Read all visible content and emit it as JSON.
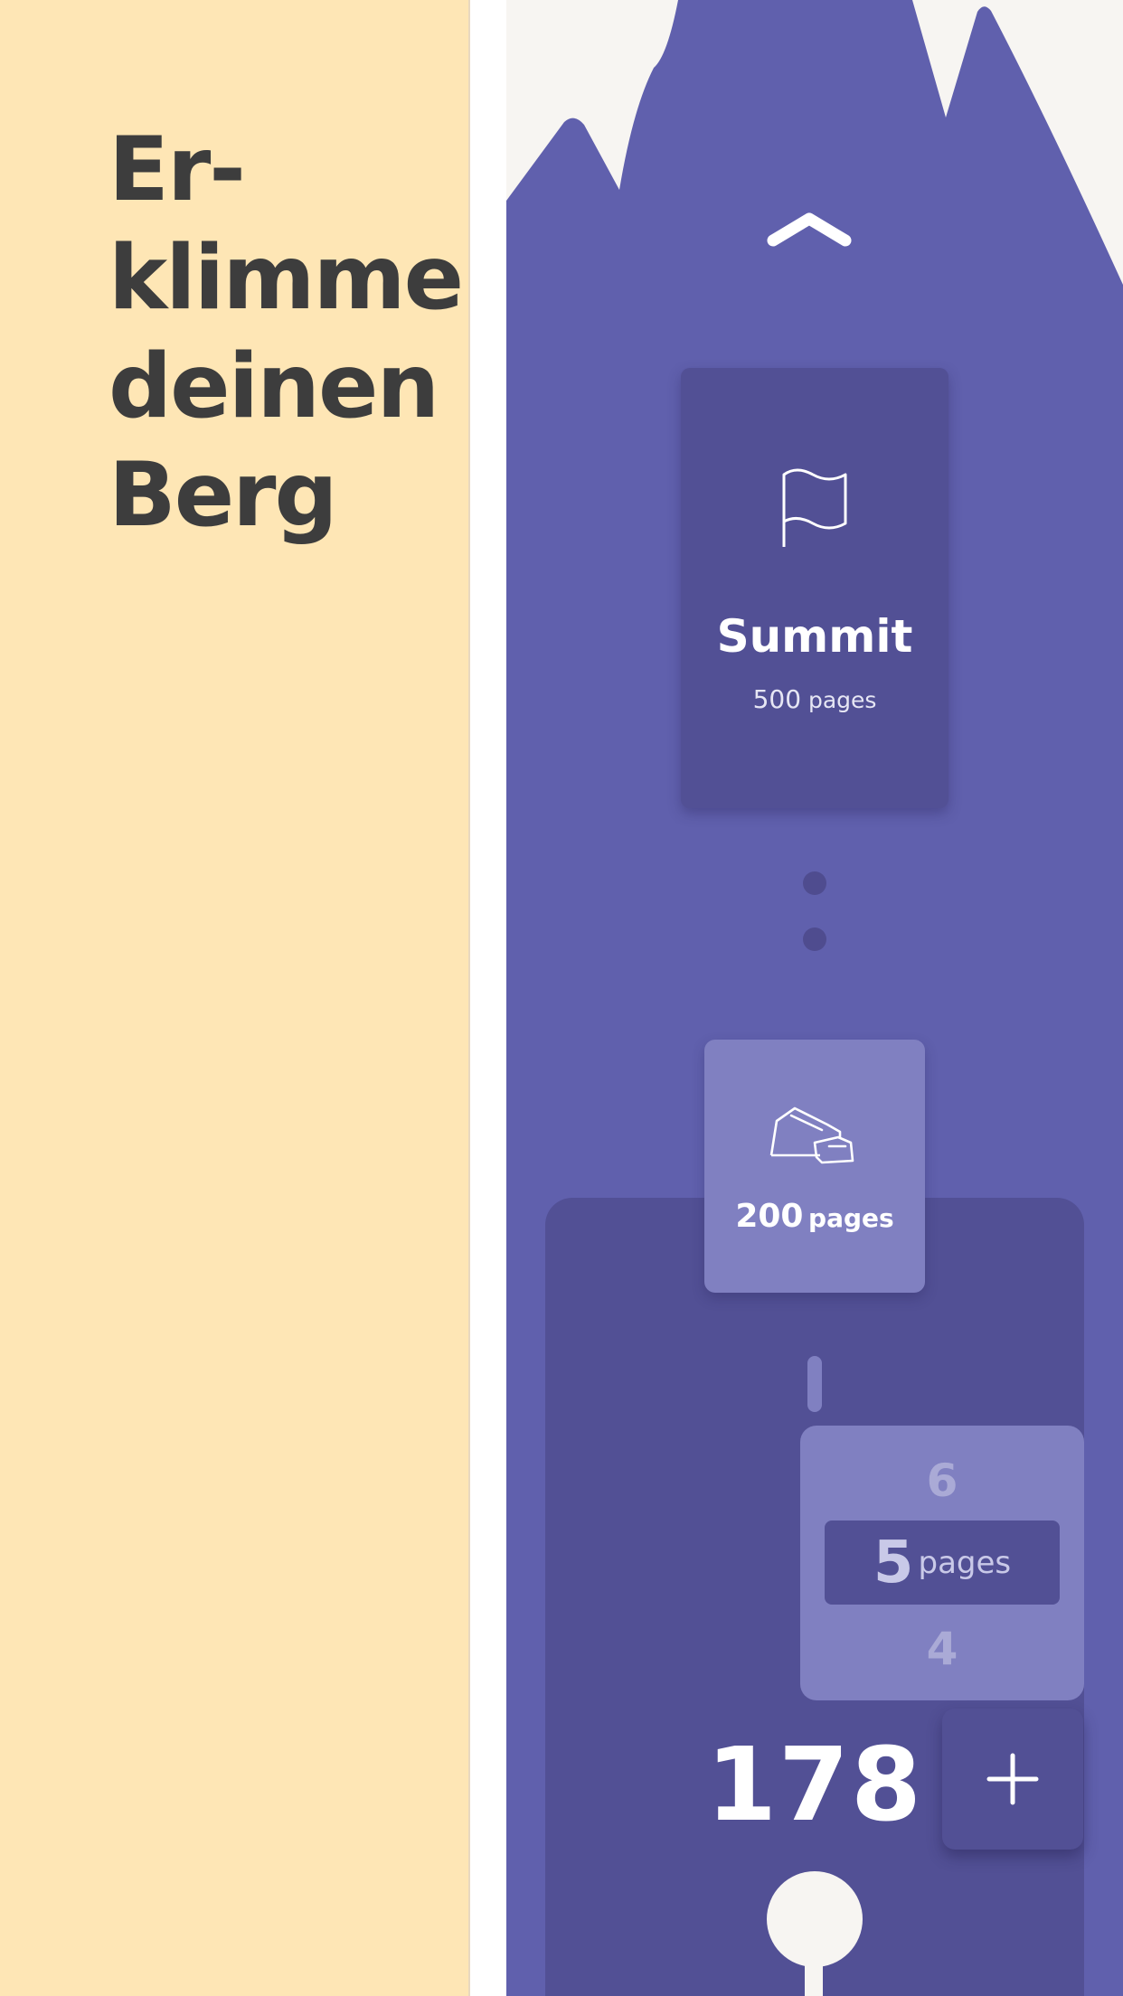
{
  "promo": {
    "headline": [
      "Er-",
      "klimme",
      "deinen",
      "Berg"
    ]
  },
  "summit_card": {
    "icon": "flag-icon",
    "title": "Summit",
    "pages_number": "500",
    "pages_unit": "pages"
  },
  "milestone_card": {
    "icon": "rock-icon",
    "pages_number": "200",
    "pages_unit": "pages"
  },
  "picker": {
    "above": "6",
    "selected_number": "5",
    "selected_unit": "pages",
    "below": "4"
  },
  "counter": "178",
  "add_button": {
    "icon": "plus-icon"
  },
  "nav": {
    "up_icon": "chevron-up-icon"
  },
  "colors": {
    "promo_background": "#fee6b5",
    "headline_text": "#3d3d3d",
    "mountain": "#6060ad",
    "sky": "#f7f5f2",
    "card_dark": "#525095",
    "card_light": "#8080c1"
  }
}
